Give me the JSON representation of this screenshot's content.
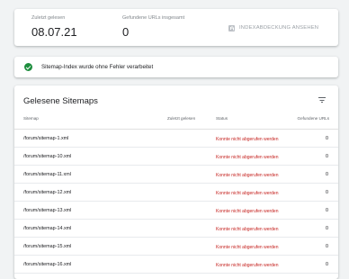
{
  "summary": {
    "last_read_label": "Zuletzt gelesen",
    "last_read_value": "08.07.21",
    "found_urls_label": "Gefundene URLs insgesamt",
    "found_urls_value": "0",
    "index_coverage_button": "INDEXABDECKUNG ANSEHEN"
  },
  "status": {
    "message": "Sitemap-Index wurde ohne Fehler verarbeitet",
    "color": "#1e8e3e"
  },
  "sitemaps": {
    "title": "Gelesene Sitemaps",
    "columns": {
      "sitemap": "Sitemap",
      "last_read": "Zuletzt gelesen",
      "status": "Status",
      "found_urls": "Gefundene URLs"
    },
    "rows": [
      {
        "path": "/forum/sitemap-1.xml",
        "last_read": "",
        "status": "Konnte nicht abgerufen werden",
        "found": "0"
      },
      {
        "path": "/forum/sitemap-10.xml",
        "last_read": "",
        "status": "Konnte nicht abgerufen werden",
        "found": "0"
      },
      {
        "path": "/forum/sitemap-11.xml",
        "last_read": "",
        "status": "Konnte nicht abgerufen werden",
        "found": "0"
      },
      {
        "path": "/forum/sitemap-12.xml",
        "last_read": "",
        "status": "Konnte nicht abgerufen werden",
        "found": "0"
      },
      {
        "path": "/forum/sitemap-13.xml",
        "last_read": "",
        "status": "Konnte nicht abgerufen werden",
        "found": "0"
      },
      {
        "path": "/forum/sitemap-14.xml",
        "last_read": "",
        "status": "Konnte nicht abgerufen werden",
        "found": "0"
      },
      {
        "path": "/forum/sitemap-15.xml",
        "last_read": "",
        "status": "Konnte nicht abgerufen werden",
        "found": "0"
      },
      {
        "path": "/forum/sitemap-16.xml",
        "last_read": "",
        "status": "Konnte nicht abgerufen werden",
        "found": "0"
      }
    ]
  },
  "colors": {
    "error": "#c5221f",
    "background": "#f1f3f4"
  },
  "icons": {
    "coverage": "bar-chart-icon",
    "status": "check-circle-icon",
    "filter": "filter-icon"
  }
}
